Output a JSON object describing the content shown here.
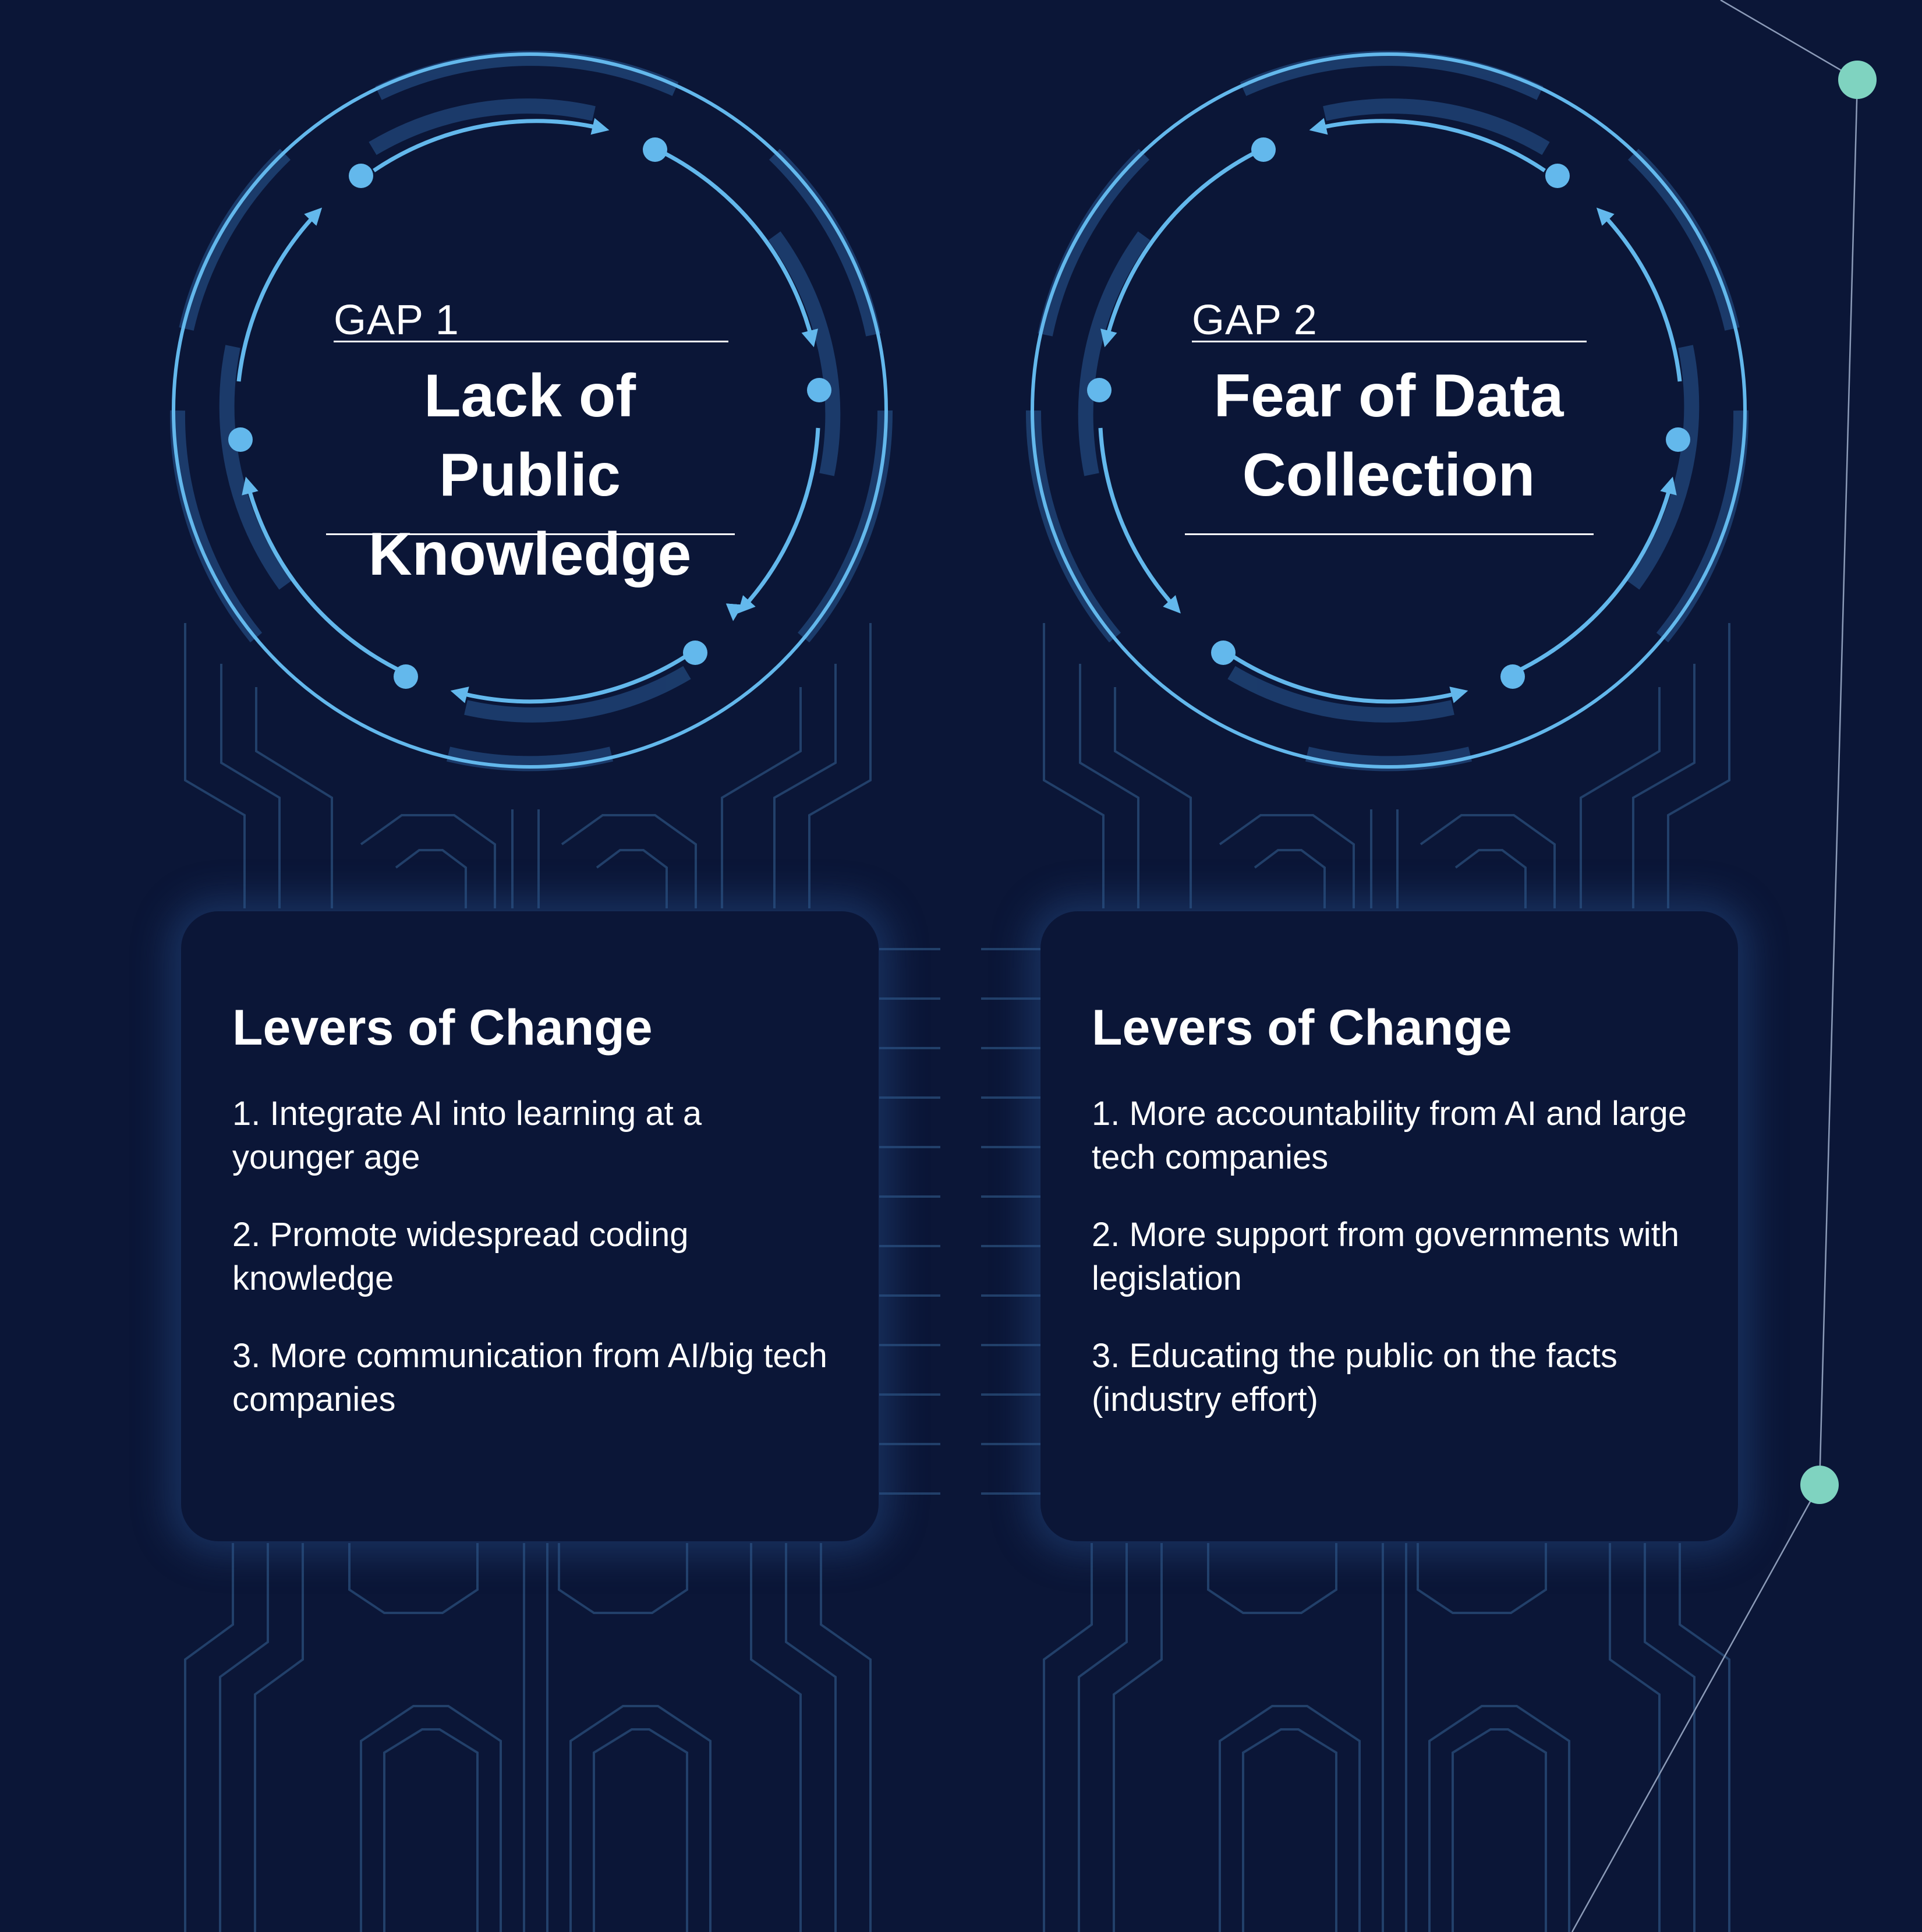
{
  "gaps": [
    {
      "label": "GAP 1",
      "title_line1": "Lack of Public",
      "title_line2": "Knowledge",
      "levers_title": "Levers of Change",
      "levers": [
        "1. Integrate AI into learning at a younger age",
        "2. Promote widespread coding knowledge",
        "3. More communication from AI/big tech companies"
      ]
    },
    {
      "label": "GAP 2",
      "title_line1": "Fear of Data",
      "title_line2": "Collection",
      "levers_title": "Levers of Change",
      "levers": [
        "1. More accountability from AI and large tech companies",
        "2. More support from governments with legislation",
        "3. Educating the public on the facts (industry effort)"
      ]
    }
  ],
  "colors": {
    "background": "#0b1637",
    "ring": "#63b8ec",
    "ring_glow": "#1d3f70",
    "circuit": "#22406a",
    "node": "#7fd3c0",
    "text": "#ffffff"
  }
}
